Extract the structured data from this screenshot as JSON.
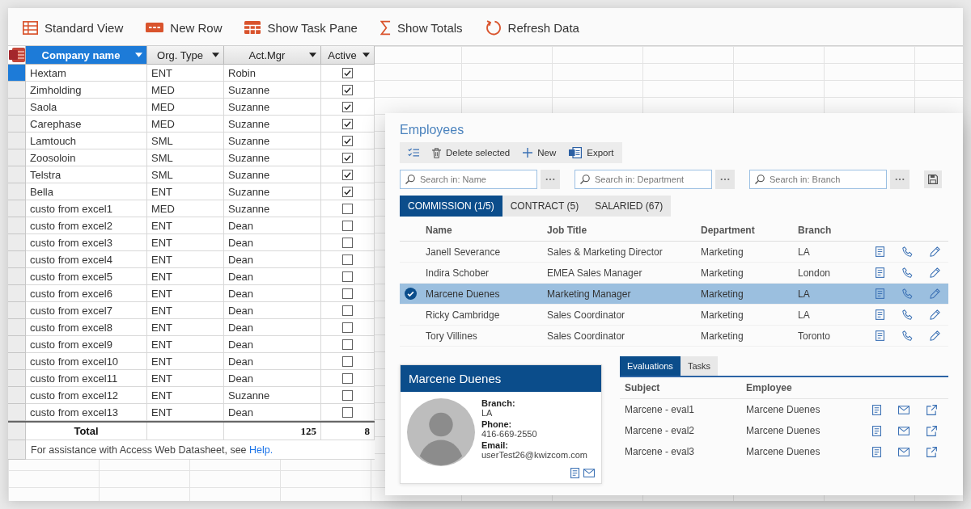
{
  "datasheet": {
    "toolbar": [
      {
        "kind": "view",
        "label": "Standard View"
      },
      {
        "kind": "new-row",
        "label": "New Row"
      },
      {
        "kind": "task-pane",
        "label": "Show Task Pane"
      },
      {
        "kind": "totals",
        "label": "Show Totals"
      },
      {
        "kind": "refresh",
        "label": "Refresh Data"
      }
    ],
    "columns": [
      {
        "label": "Company name",
        "selected": true
      },
      {
        "label": "Org. Type",
        "selected": false
      },
      {
        "label": "Act.Mgr",
        "selected": false
      },
      {
        "label": "Active",
        "selected": false
      }
    ],
    "rows": [
      {
        "company": "Hextam",
        "org_type": "ENT",
        "act_mgr": "Robin",
        "active": true,
        "selected": true
      },
      {
        "company": "Zimholding",
        "org_type": "MED",
        "act_mgr": "Suzanne",
        "active": true,
        "selected": false
      },
      {
        "company": "Saola",
        "org_type": "MED",
        "act_mgr": "Suzanne",
        "active": true,
        "selected": false
      },
      {
        "company": "Carephase",
        "org_type": "MED",
        "act_mgr": "Suzanne",
        "active": true,
        "selected": false
      },
      {
        "company": "Lamtouch",
        "org_type": "SML",
        "act_mgr": "Suzanne",
        "active": true,
        "selected": false
      },
      {
        "company": "Zoosoloin",
        "org_type": "SML",
        "act_mgr": "Suzanne",
        "active": true,
        "selected": false
      },
      {
        "company": "Telstra",
        "org_type": "SML",
        "act_mgr": "Suzanne",
        "active": true,
        "selected": false
      },
      {
        "company": "Bella",
        "org_type": "ENT",
        "act_mgr": "Suzanne",
        "active": true,
        "selected": false
      },
      {
        "company": "custo from excel1",
        "org_type": "MED",
        "act_mgr": "Suzanne",
        "active": false,
        "selected": false
      },
      {
        "company": "custo from excel2",
        "org_type": "ENT",
        "act_mgr": "Dean",
        "active": false,
        "selected": false
      },
      {
        "company": "custo from excel3",
        "org_type": "ENT",
        "act_mgr": "Dean",
        "active": false,
        "selected": false
      },
      {
        "company": "custo from excel4",
        "org_type": "ENT",
        "act_mgr": "Dean",
        "active": false,
        "selected": false
      },
      {
        "company": "custo from excel5",
        "org_type": "ENT",
        "act_mgr": "Dean",
        "active": false,
        "selected": false
      },
      {
        "company": "custo from excel6",
        "org_type": "ENT",
        "act_mgr": "Dean",
        "active": false,
        "selected": false
      },
      {
        "company": "custo from excel7",
        "org_type": "ENT",
        "act_mgr": "Dean",
        "active": false,
        "selected": false
      },
      {
        "company": "custo from excel8",
        "org_type": "ENT",
        "act_mgr": "Dean",
        "active": false,
        "selected": false
      },
      {
        "company": "custo from excel9",
        "org_type": "ENT",
        "act_mgr": "Dean",
        "active": false,
        "selected": false
      },
      {
        "company": "custo from excel10",
        "org_type": "ENT",
        "act_mgr": "Dean",
        "active": false,
        "selected": false
      },
      {
        "company": "custo from excel11",
        "org_type": "ENT",
        "act_mgr": "Dean",
        "active": false,
        "selected": false
      },
      {
        "company": "custo from excel12",
        "org_type": "ENT",
        "act_mgr": "Suzanne",
        "active": false,
        "selected": false
      },
      {
        "company": "custo from excel13",
        "org_type": "ENT",
        "act_mgr": "Dean",
        "active": false,
        "selected": false
      }
    ],
    "totals": {
      "label": "Total",
      "act_mgr": "125",
      "active": "8"
    },
    "footer": {
      "text": "For assistance with Access Web Datasheet, see",
      "link": "Help."
    }
  },
  "employees": {
    "title": "Employees",
    "toolbar": [
      {
        "kind": "select"
      },
      {
        "kind": "delete",
        "label": "Delete selected"
      },
      {
        "kind": "new",
        "label": "New"
      },
      {
        "kind": "export",
        "label": "Export"
      }
    ],
    "searches": [
      {
        "placeholder": "Search in: Name"
      },
      {
        "placeholder": "Search in: Department"
      },
      {
        "placeholder": "Search in: Branch"
      }
    ],
    "tabs": [
      {
        "label": "COMMISSION (1/5)",
        "selected": true
      },
      {
        "label": "CONTRACT (5)",
        "selected": false
      },
      {
        "label": "SALARIED (67)",
        "selected": false
      }
    ],
    "columns": [
      "Name",
      "Job Title",
      "Department",
      "Branch"
    ],
    "rows": [
      {
        "name": "Janell Severance",
        "job_title": "Sales & Marketing Director",
        "department": "Marketing",
        "branch": "LA",
        "selected": false
      },
      {
        "name": "Indira Schober",
        "job_title": "EMEA Sales Manager",
        "department": "Marketing",
        "branch": "London",
        "selected": false
      },
      {
        "name": "Marcene Duenes",
        "job_title": "Marketing Manager",
        "department": "Marketing",
        "branch": "LA",
        "selected": true
      },
      {
        "name": "Ricky Cambridge",
        "job_title": "Sales Coordinator",
        "department": "Marketing",
        "branch": "LA",
        "selected": false
      },
      {
        "name": "Tory Villines",
        "job_title": "Sales Coordinator",
        "department": "Marketing",
        "branch": "Toronto",
        "selected": false
      }
    ],
    "card": {
      "name": "Marcene Duenes",
      "fields": [
        {
          "label": "Branch:",
          "value": "LA"
        },
        {
          "label": "Phone:",
          "value": "416-669-2550"
        },
        {
          "label": "Email:",
          "value": "userTest26@kwizcom.com"
        }
      ]
    },
    "detail_tabs": [
      {
        "label": "Evaluations",
        "selected": true
      },
      {
        "label": "Tasks",
        "selected": false
      }
    ],
    "detail_columns": [
      "Subject",
      "Employee"
    ],
    "detail_rows": [
      {
        "subject": "Marcene - eval1",
        "employee": "Marcene Duenes"
      },
      {
        "subject": "Marcene - eval2",
        "employee": "Marcene Duenes"
      },
      {
        "subject": "Marcene - eval3",
        "employee": "Marcene Duenes"
      }
    ]
  }
}
